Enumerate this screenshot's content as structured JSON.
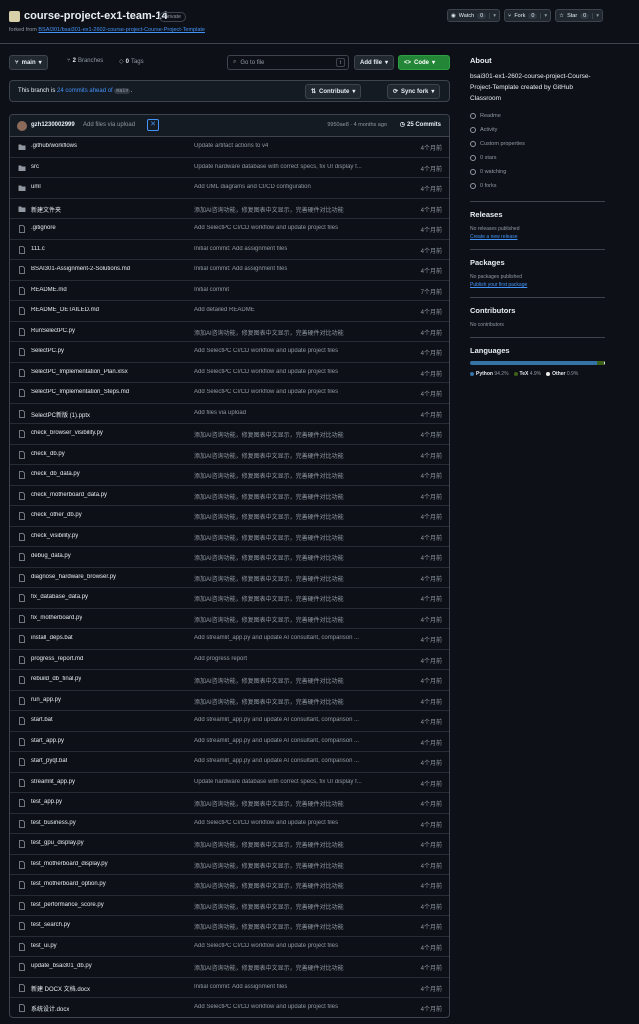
{
  "repo": {
    "name": "course-project-ex1-team-14",
    "visibility": "Private",
    "forked_prefix": "forked from",
    "forked_from": "BSAI301/bsai301-ex1-2602-course-project-Course-Project-Template",
    "watch_label": "Watch",
    "watch_count": "0",
    "fork_label": "Fork",
    "fork_count": "0",
    "star_label": "Star",
    "star_count": "0"
  },
  "toolbar": {
    "branch": "main",
    "branches_count": "2",
    "branches_label": "Branches",
    "tags_count": "0",
    "tags_label": "Tags",
    "goto_placeholder": "Go to file",
    "goto_key": "t",
    "add_file": "Add file",
    "code": "Code"
  },
  "ahead_bar": {
    "prefix": "This branch is",
    "link": "24 commits ahead of",
    "branch_code": "main",
    "suffix": ".",
    "contribute": "Contribute",
    "sync": "Sync fork"
  },
  "latest_commit": {
    "user": "gzh1230002999",
    "message": "Add files via upload",
    "meta": "9950ae8 · 4 months ago",
    "commits_count": "25 Commits"
  },
  "files": [
    {
      "name": ".github/workflows",
      "type": "dir",
      "msg": "Update artifact actions to v4",
      "date": "4个月前"
    },
    {
      "name": "src",
      "type": "dir",
      "msg": "Update hardware database with correct specs, fix UI display f...",
      "date": "4个月前"
    },
    {
      "name": "uml",
      "type": "dir",
      "msg": "Add UML diagrams and CI/CD configuration",
      "date": "4个月前"
    },
    {
      "name": "新建文件夹",
      "type": "dir",
      "msg": "添加AI咨询功能，修复图表中文显示，完善硬件对比功能",
      "date": "4个月前"
    },
    {
      "name": ".gitignore",
      "type": "file",
      "msg": "Add SelectPC CI/CD workflow and update project files",
      "date": "4个月前"
    },
    {
      "name": "111.c",
      "type": "file",
      "msg": "Initial commit: Add assignment files",
      "date": "4个月前"
    },
    {
      "name": "BSAI301-Assignment-2-Solutions.md",
      "type": "file",
      "msg": "Initial commit: Add assignment files",
      "date": "4个月前"
    },
    {
      "name": "README.md",
      "type": "file",
      "msg": "Initial commit",
      "date": "7个月前"
    },
    {
      "name": "README_DETAILED.md",
      "type": "file",
      "msg": "Add detailed README",
      "date": "4个月前"
    },
    {
      "name": "RunSelectPC.py",
      "type": "file",
      "msg": "添加AI咨询功能，修复图表中文显示，完善硬件对比功能",
      "date": "4个月前"
    },
    {
      "name": "SelectPC.py",
      "type": "file",
      "msg": "Add SelectPC CI/CD workflow and update project files",
      "date": "4个月前"
    },
    {
      "name": "SelectPC_Implementation_Plan.xlsx",
      "type": "file",
      "msg": "Add SelectPC CI/CD workflow and update project files",
      "date": "4个月前"
    },
    {
      "name": "SelectPC_Implementation_Steps.md",
      "type": "file",
      "msg": "Add SelectPC CI/CD workflow and update project files",
      "date": "4个月前"
    },
    {
      "name": "SelectPC新版 (1).pptx",
      "type": "file",
      "msg": "Add files via upload",
      "date": "4个月前"
    },
    {
      "name": "check_browser_visibility.py",
      "type": "file",
      "msg": "添加AI咨询功能，修复图表中文显示，完善硬件对比功能",
      "date": "4个月前"
    },
    {
      "name": "check_db.py",
      "type": "file",
      "msg": "添加AI咨询功能，修复图表中文显示，完善硬件对比功能",
      "date": "4个月前"
    },
    {
      "name": "check_db_data.py",
      "type": "file",
      "msg": "添加AI咨询功能，修复图表中文显示，完善硬件对比功能",
      "date": "4个月前"
    },
    {
      "name": "check_motherboard_data.py",
      "type": "file",
      "msg": "添加AI咨询功能，修复图表中文显示，完善硬件对比功能",
      "date": "4个月前"
    },
    {
      "name": "check_other_db.py",
      "type": "file",
      "msg": "添加AI咨询功能，修复图表中文显示，完善硬件对比功能",
      "date": "4个月前"
    },
    {
      "name": "check_visibility.py",
      "type": "file",
      "msg": "添加AI咨询功能，修复图表中文显示，完善硬件对比功能",
      "date": "4个月前"
    },
    {
      "name": "debug_data.py",
      "type": "file",
      "msg": "添加AI咨询功能，修复图表中文显示，完善硬件对比功能",
      "date": "4个月前"
    },
    {
      "name": "diagnose_hardware_browser.py",
      "type": "file",
      "msg": "添加AI咨询功能，修复图表中文显示，完善硬件对比功能",
      "date": "4个月前"
    },
    {
      "name": "fix_database_data.py",
      "type": "file",
      "msg": "添加AI咨询功能，修复图表中文显示，完善硬件对比功能",
      "date": "4个月前"
    },
    {
      "name": "fix_motherboard.py",
      "type": "file",
      "msg": "添加AI咨询功能，修复图表中文显示，完善硬件对比功能",
      "date": "4个月前"
    },
    {
      "name": "install_deps.bat",
      "type": "file",
      "msg": "Add streamlit_app.py and update AI consultant, comparison ...",
      "date": "4个月前"
    },
    {
      "name": "progress_report.md",
      "type": "file",
      "msg": "Add progress report",
      "date": "4个月前"
    },
    {
      "name": "rebuild_db_final.py",
      "type": "file",
      "msg": "添加AI咨询功能，修复图表中文显示，完善硬件对比功能",
      "date": "4个月前"
    },
    {
      "name": "run_app.py",
      "type": "file",
      "msg": "添加AI咨询功能，修复图表中文显示，完善硬件对比功能",
      "date": "4个月前"
    },
    {
      "name": "start.bat",
      "type": "file",
      "msg": "Add streamlit_app.py and update AI consultant, comparison ...",
      "date": "4个月前"
    },
    {
      "name": "start_app.py",
      "type": "file",
      "msg": "Add streamlit_app.py and update AI consultant, comparison ...",
      "date": "4个月前"
    },
    {
      "name": "start_pyqt.bat",
      "type": "file",
      "msg": "Add streamlit_app.py and update AI consultant, comparison ...",
      "date": "4个月前"
    },
    {
      "name": "streamlit_app.py",
      "type": "file",
      "msg": "Update hardware database with correct specs, fix UI display f...",
      "date": "4个月前"
    },
    {
      "name": "test_app.py",
      "type": "file",
      "msg": "添加AI咨询功能，修复图表中文显示，完善硬件对比功能",
      "date": "4个月前"
    },
    {
      "name": "test_business.py",
      "type": "file",
      "msg": "Add SelectPC CI/CD workflow and update project files",
      "date": "4个月前"
    },
    {
      "name": "test_gpu_display.py",
      "type": "file",
      "msg": "添加AI咨询功能，修复图表中文显示，完善硬件对比功能",
      "date": "4个月前"
    },
    {
      "name": "test_motherboard_display.py",
      "type": "file",
      "msg": "添加AI咨询功能，修复图表中文显示，完善硬件对比功能",
      "date": "4个月前"
    },
    {
      "name": "test_motherboard_option.py",
      "type": "file",
      "msg": "添加AI咨询功能，修复图表中文显示，完善硬件对比功能",
      "date": "4个月前"
    },
    {
      "name": "test_performance_score.py",
      "type": "file",
      "msg": "添加AI咨询功能，修复图表中文显示，完善硬件对比功能",
      "date": "4个月前"
    },
    {
      "name": "test_search.py",
      "type": "file",
      "msg": "添加AI咨询功能，修复图表中文显示，完善硬件对比功能",
      "date": "4个月前"
    },
    {
      "name": "test_ui.py",
      "type": "file",
      "msg": "Add SelectPC CI/CD workflow and update project files",
      "date": "4个月前"
    },
    {
      "name": "update_bsai301_db.py",
      "type": "file",
      "msg": "添加AI咨询功能，修复图表中文显示，完善硬件对比功能",
      "date": "4个月前"
    },
    {
      "name": "新建 DOCX 文档.docx",
      "type": "file",
      "msg": "Initial commit: Add assignment files",
      "date": "4个月前"
    },
    {
      "name": "系统设计.docx",
      "type": "file",
      "msg": "Add SelectPC CI/CD workflow and update project files",
      "date": "4个月前"
    }
  ],
  "sidebar": {
    "about_title": "About",
    "about_desc": "bsai301-ex1-2602-course-project-Course-Project-Template created by GitHub Classroom",
    "links": [
      {
        "icon": "book-icon",
        "label": "Readme"
      },
      {
        "icon": "pulse-icon",
        "label": "Activity"
      },
      {
        "icon": "gear-icon",
        "label": "Custom properties"
      },
      {
        "icon": "star-icon",
        "label": "0 stars"
      },
      {
        "icon": "eye-icon",
        "label": "0 watching"
      },
      {
        "icon": "fork-icon",
        "label": "0 forks"
      }
    ],
    "releases_title": "Releases",
    "releases_none": "No releases published",
    "releases_link": "Create a new release",
    "packages_title": "Packages",
    "packages_none": "No packages published",
    "packages_link": "Publish your first package",
    "contributors_title": "Contributors",
    "contributors_none": "No contributors",
    "languages_title": "Languages",
    "languages": [
      {
        "name": "Python",
        "pct": "94.2%",
        "value": 94.2,
        "color": "#3572A5"
      },
      {
        "name": "TeX",
        "pct": "4.9%",
        "value": 4.9,
        "color": "#3D6117"
      },
      {
        "name": "Other",
        "pct": "0.9%",
        "value": 0.9,
        "color": "#ededed"
      }
    ]
  },
  "colors": {
    "bg": "#0d1117",
    "accent": "#4493f8",
    "code_btn": "#238636",
    "dir_icon": "#9198a1"
  }
}
